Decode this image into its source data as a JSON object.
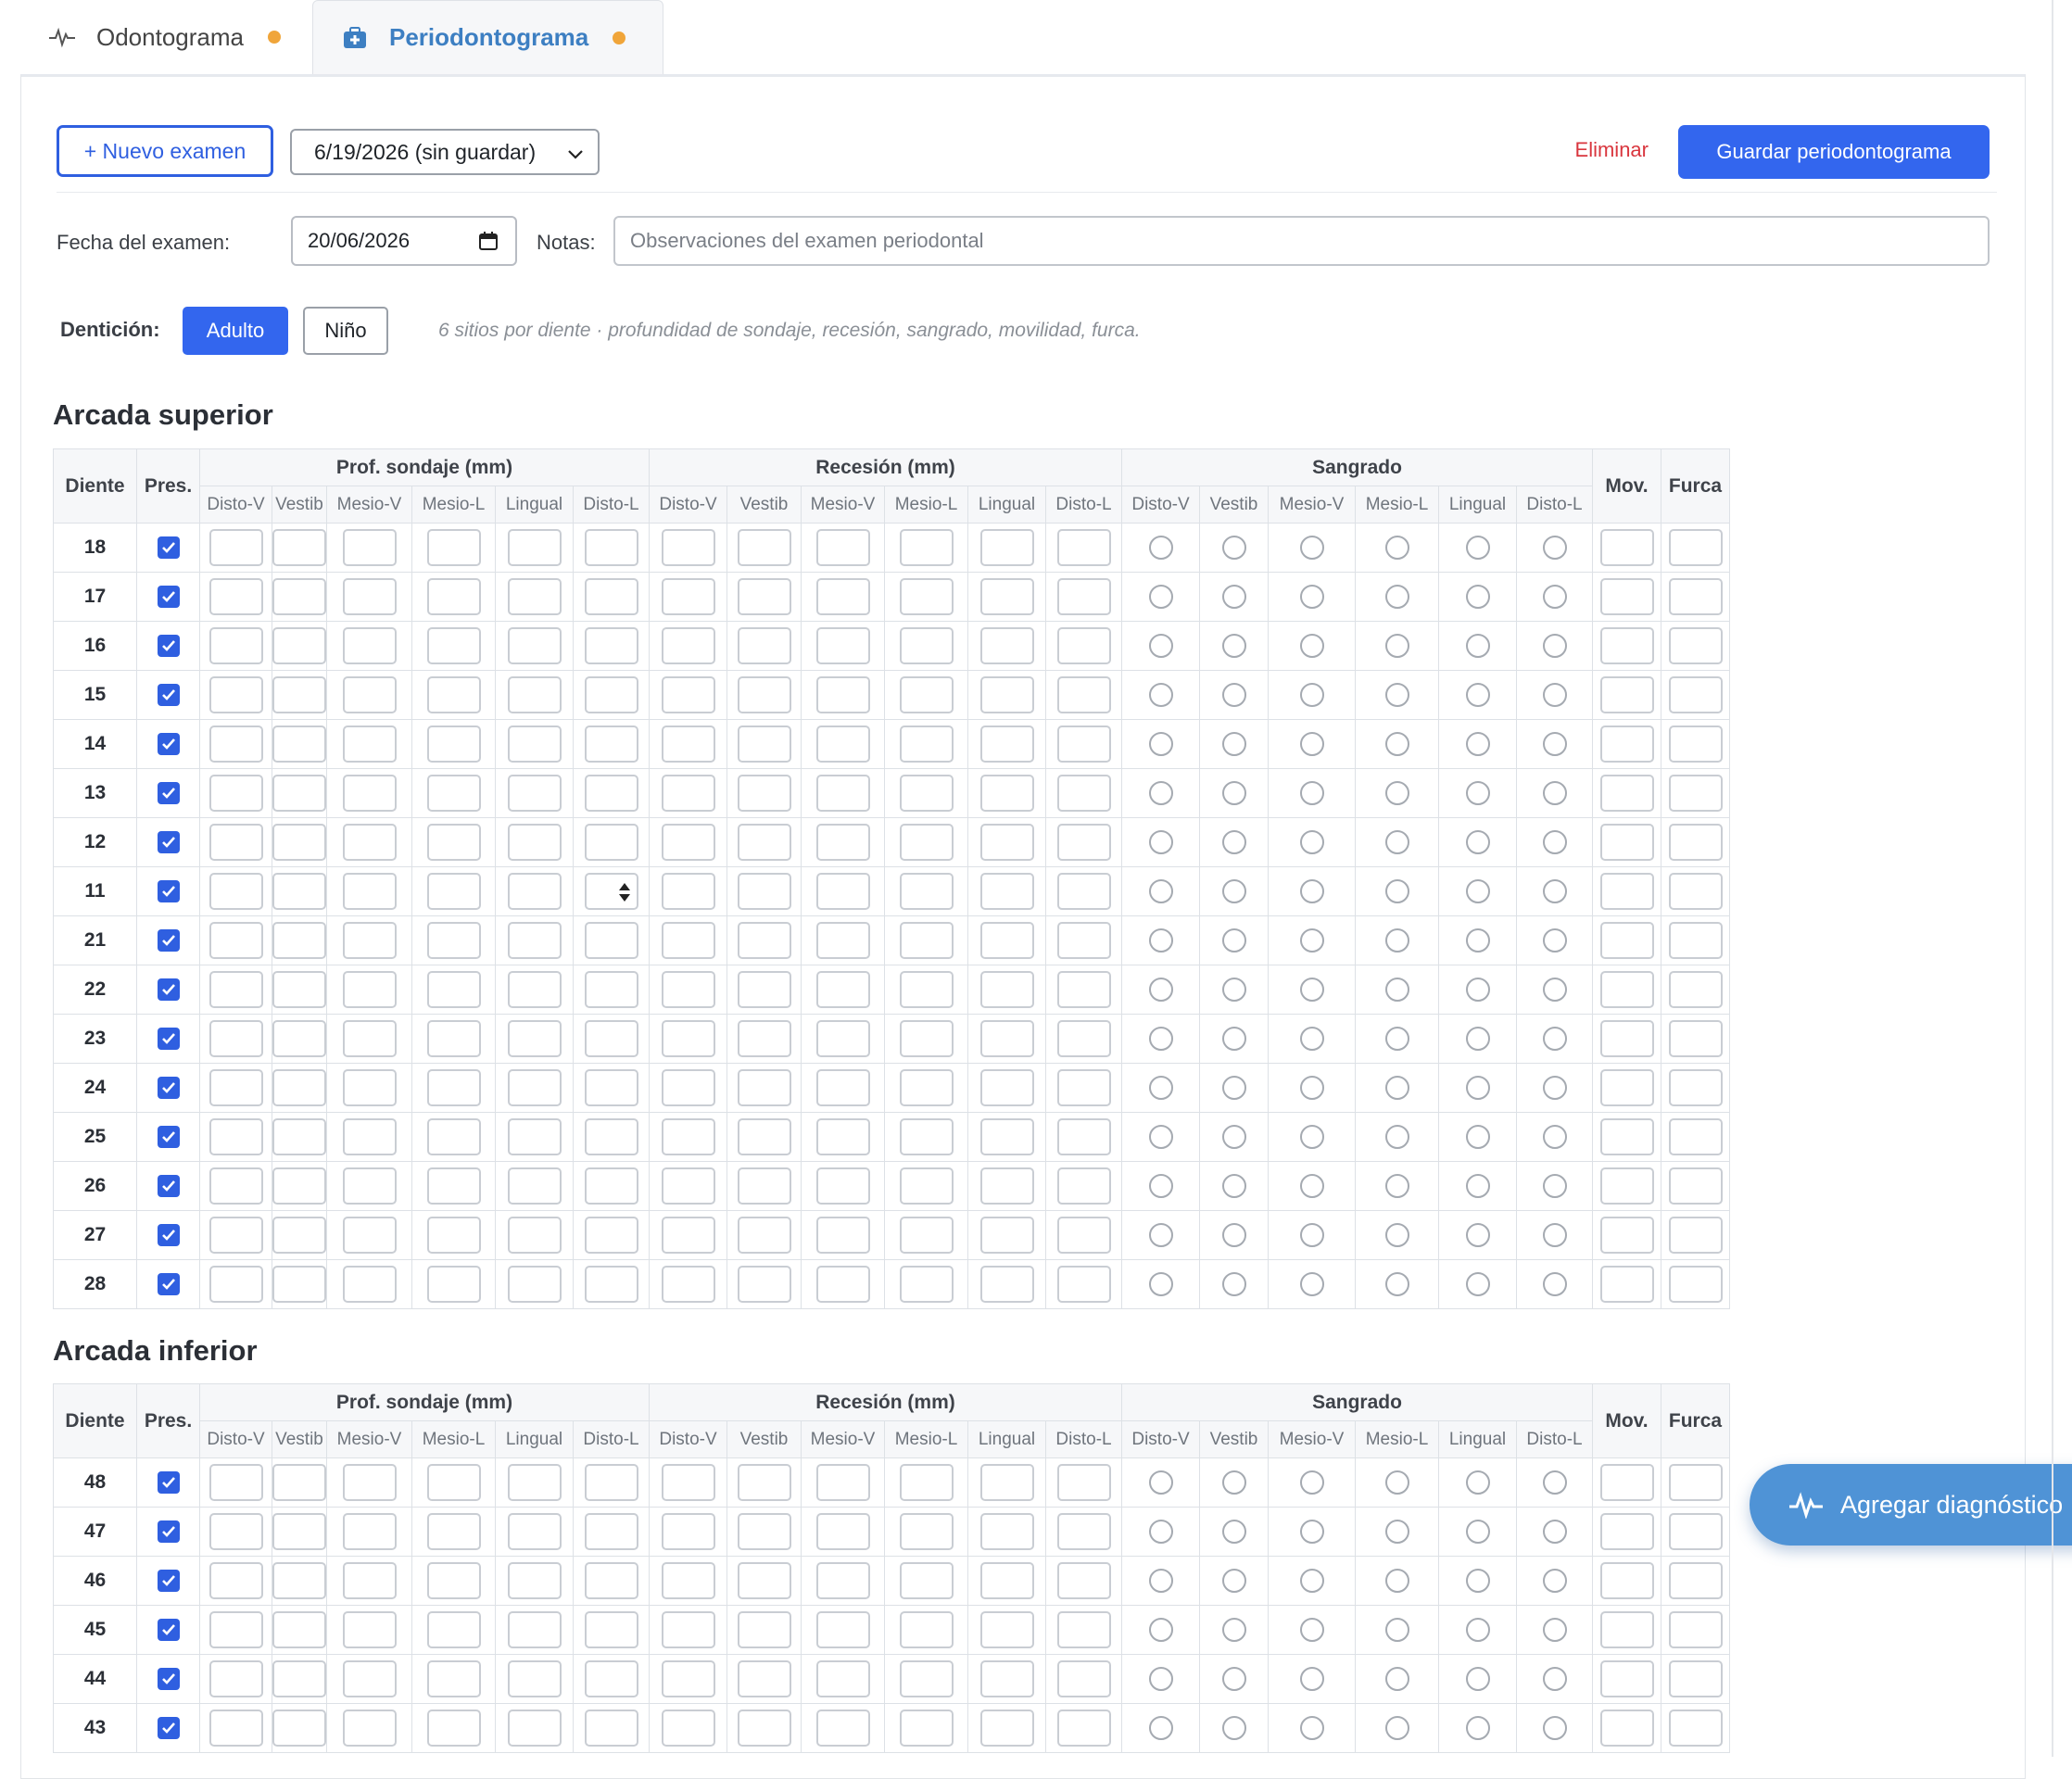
{
  "tabs": [
    {
      "label": "Odontograma",
      "icon": "pulse-icon",
      "active": false,
      "dot_color": "#f0a53a"
    },
    {
      "label": "Periodontograma",
      "icon": "medical-kit-icon",
      "active": true,
      "dot_color": "#f0a53a"
    }
  ],
  "toolbar": {
    "new_exam_label": "+ Nuevo examen",
    "exam_select_value": "6/19/2026 (sin guardar)",
    "delete_label": "Eliminar",
    "save_label": "Guardar periodontograma"
  },
  "exam": {
    "date_label": "Fecha del examen:",
    "date_value": "20/06/2026",
    "notes_label": "Notas:",
    "notes_placeholder": "Observaciones del examen periodontal"
  },
  "dentition": {
    "label": "Dentición:",
    "adult_label": "Adulto",
    "child_label": "Niño",
    "hint": "6 sitios por diente · profundidad de sondaje, recesión, sangrado, movilidad, furca."
  },
  "table_headers": {
    "tooth": "Diente",
    "present": "Pres.",
    "probing": "Prof. sondaje (mm)",
    "recession": "Recesión (mm)",
    "bleeding": "Sangrado",
    "mobility": "Mov.",
    "furcation": "Furca",
    "sites": [
      "Disto-V",
      "Vestib",
      "Mesio-V",
      "Mesio-L",
      "Lingual",
      "Disto-L"
    ]
  },
  "upper": {
    "title": "Arcada superior",
    "teeth": [
      "18",
      "17",
      "16",
      "15",
      "14",
      "13",
      "12",
      "11",
      "21",
      "22",
      "23",
      "24",
      "25",
      "26",
      "27",
      "28"
    ]
  },
  "lower": {
    "title": "Arcada inferior",
    "teeth": [
      "48",
      "47",
      "46",
      "45",
      "44",
      "43"
    ]
  },
  "fab": {
    "label": "Agregar diagnóstico",
    "icon": "pulse-icon"
  },
  "colors": {
    "primary": "#3366ee",
    "accent_tab": "#3d7fc2",
    "danger": "#d9363e",
    "dot": "#f0a53a",
    "fab": "#4f93d6"
  }
}
